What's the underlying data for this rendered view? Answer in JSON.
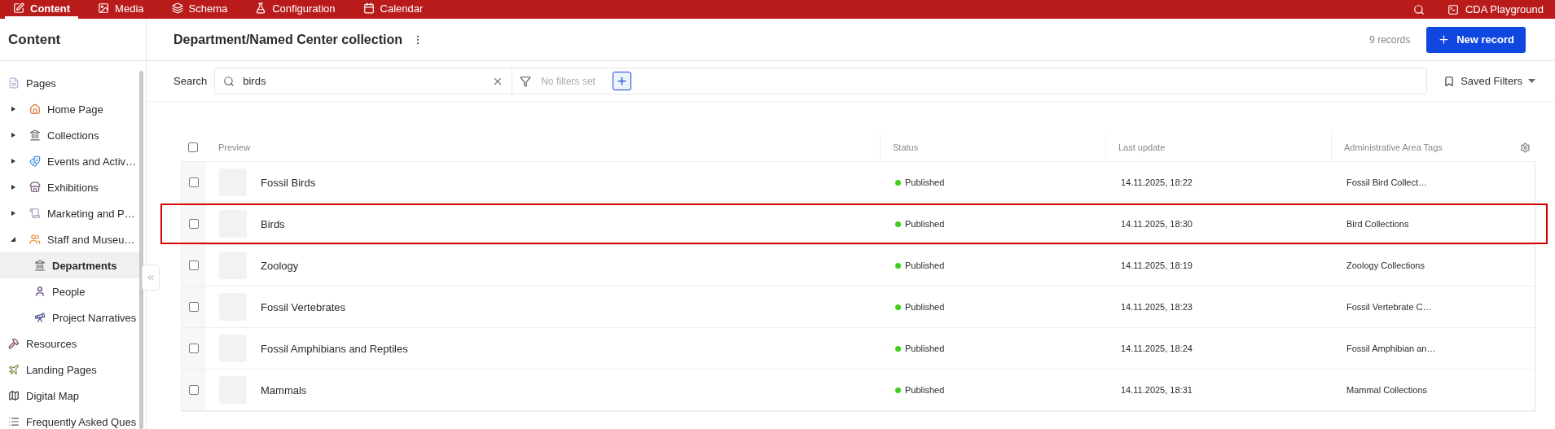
{
  "top_nav": {
    "tabs": [
      {
        "label": "Content",
        "selected": true
      },
      {
        "label": "Media",
        "selected": false
      },
      {
        "label": "Schema",
        "selected": false
      },
      {
        "label": "Configuration",
        "selected": false
      },
      {
        "label": "Calendar",
        "selected": false
      }
    ],
    "workspace": "CDA Playground"
  },
  "sidebar": {
    "title": "Content",
    "items": [
      {
        "label": "Pages",
        "selected": false,
        "children": [
          {
            "label": "Home Page",
            "selected": false,
            "expanded": false
          },
          {
            "label": "Collections",
            "selected": false,
            "expanded": false
          },
          {
            "label": "Events and Activ…",
            "selected": false,
            "expanded": false
          },
          {
            "label": "Exhibitions",
            "selected": false,
            "expanded": false
          },
          {
            "label": "Marketing and P…",
            "selected": false,
            "expanded": false
          },
          {
            "label": "Staff and Museu…",
            "selected": false,
            "expanded": true,
            "children": [
              {
                "label": "Departments",
                "selected": true
              },
              {
                "label": "People",
                "selected": false
              },
              {
                "label": "Project Narratives",
                "selected": false
              }
            ]
          }
        ]
      },
      {
        "label": "Resources",
        "selected": false
      },
      {
        "label": "Landing Pages",
        "selected": false
      },
      {
        "label": "Digital Map",
        "selected": false
      },
      {
        "label": "Frequently Asked Ques",
        "selected": false
      }
    ]
  },
  "header": {
    "title": "Department/Named Center collection",
    "record_count": "9 records",
    "new_button": "New record"
  },
  "search": {
    "label": "Search",
    "value": "birds",
    "filter_placeholder": "No filters set",
    "saved_filters": "Saved Filters"
  },
  "table": {
    "columns": [
      "Preview",
      "Status",
      "Last update",
      "Administrative Area Tags"
    ],
    "all_checked": false,
    "rows": [
      {
        "name": "Fossil Birds",
        "status": "Published",
        "color": "#3ccf1a",
        "updated": "14.11.2025, 18:22",
        "tags": "Fossil Bird Collect…",
        "checked": false,
        "highlighted": false
      },
      {
        "name": "Birds",
        "status": "Published",
        "color": "#3ccf1a",
        "updated": "14.11.2025, 18:30",
        "tags": "Bird Collections",
        "checked": false,
        "highlighted": true
      },
      {
        "name": "Zoology",
        "status": "Published",
        "color": "#3ccf1a",
        "updated": "14.11.2025, 18:19",
        "tags": "Zoology Collections",
        "checked": false,
        "highlighted": false
      },
      {
        "name": "Fossil Vertebrates",
        "status": "Published",
        "color": "#3ccf1a",
        "updated": "14.11.2025, 18:23",
        "tags": "Fossil Vertebrate C…",
        "checked": false,
        "highlighted": false
      },
      {
        "name": "Fossil Amphibians and Reptiles",
        "status": "Published",
        "color": "#3ccf1a",
        "updated": "14.11.2025, 18:24",
        "tags": "Fossil Amphibian an…",
        "checked": false,
        "highlighted": false
      },
      {
        "name": "Mammals",
        "status": "Published",
        "color": "#3ccf1a",
        "updated": "14.11.2025, 18:31",
        "tags": "Mammal Collections",
        "checked": false,
        "highlighted": false
      }
    ]
  }
}
